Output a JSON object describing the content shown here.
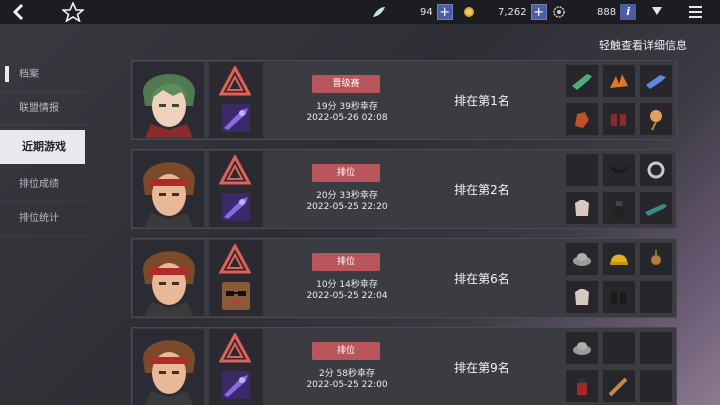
{
  "topbar": {
    "back_icon": "back-arrow-icon",
    "star_icon": "star-logo-icon",
    "currencies": [
      {
        "icon": "feather-gem-icon",
        "value": "94",
        "has_plus": true
      },
      {
        "icon": "gold-coin-icon",
        "value": "7,262",
        "has_plus": true
      },
      {
        "icon": "gear-token-icon",
        "value": "888",
        "has_info": true
      }
    ],
    "plus_label": "+",
    "info_label": "i"
  },
  "hint": "轻触查看详细信息",
  "sidebar": {
    "items": [
      {
        "label": "档案",
        "active": false
      },
      {
        "label": "联盟情报",
        "active": false
      },
      {
        "label": "近期游戏",
        "active": true
      },
      {
        "label": "排位成绩",
        "active": false
      },
      {
        "label": "排位统计",
        "active": false
      }
    ]
  },
  "matches": [
    {
      "character": "green-hair-character",
      "weapon": "purple-blade-weapon",
      "mode": "晋级赛",
      "survival": "19分 39秒幸存",
      "datetime": "2022-05-26 02:08",
      "rank": "排在第1名",
      "items": [
        "green-gun",
        "orange-claw",
        "blue-gun",
        "red-glove",
        "red-boots",
        "amulet"
      ]
    },
    {
      "character": "headband-character",
      "weapon": "purple-blade-weapon",
      "mode": "排位",
      "survival": "20分 33秒幸存",
      "datetime": "2022-05-25 22:20",
      "rank": "排在第2名",
      "items": [
        "empty",
        "dark-necklace",
        "silver-ring",
        "cloth-armor",
        "dark-potion",
        "teal-rifle"
      ]
    },
    {
      "character": "headband-character",
      "weapon": "sunglasses-weapon",
      "mode": "排位",
      "survival": "10分 14秒幸存",
      "datetime": "2022-05-25 22:04",
      "rank": "排在第6名",
      "items": [
        "grey-hat",
        "yellow-helmet",
        "bronze-amulet",
        "cloth-armor",
        "black-boots",
        "empty"
      ]
    },
    {
      "character": "headband-character",
      "weapon": "purple-blade-weapon",
      "mode": "排位",
      "survival": "2分 58秒幸存",
      "datetime": "2022-05-25 22:00",
      "rank": "排在第9名",
      "items": [
        "grey-hat",
        "empty",
        "empty",
        "red-bottle",
        "wooden-club",
        "empty"
      ]
    }
  ]
}
